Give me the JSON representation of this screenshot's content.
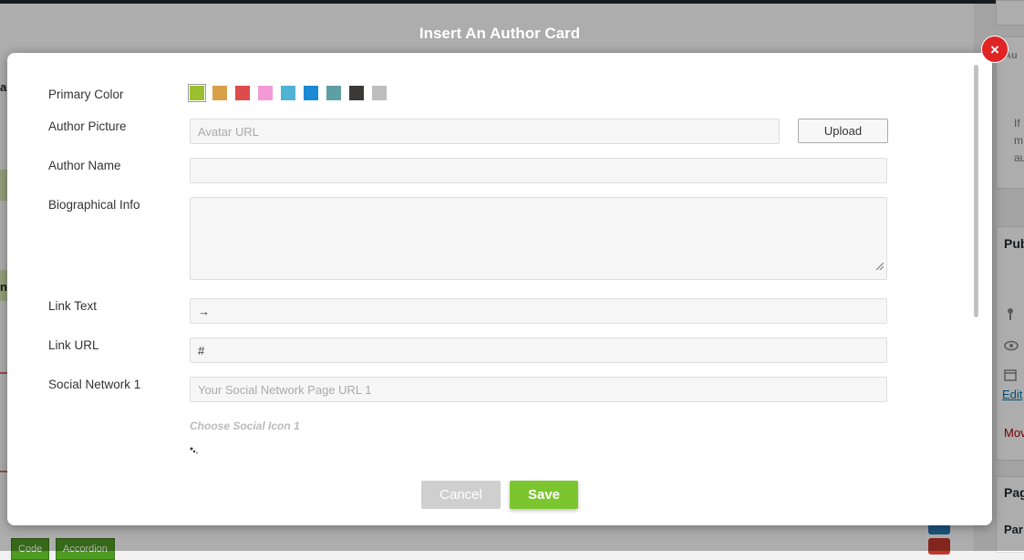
{
  "background": {
    "left_letters": [
      "a",
      "n"
    ],
    "sidebar": {
      "publish_label": "Pub",
      "edit_link": "Edit",
      "move_link": "Mov",
      "page_label": "Pag",
      "parent_label": "Par",
      "top_label": "Au",
      "note_lines": [
        "If",
        "m",
        "au"
      ]
    },
    "bottom_buttons": [
      "Code",
      "Accordion"
    ]
  },
  "modal": {
    "title": "Insert An Author Card",
    "close_glyph": "×",
    "fields": {
      "primary_color_label": "Primary Color",
      "author_picture_label": "Author Picture",
      "author_picture_placeholder": "Avatar URL",
      "upload_label": "Upload",
      "author_name_label": "Author Name",
      "author_name_value": "",
      "bio_label": "Biographical Info",
      "bio_value": "",
      "link_text_label": "Link Text",
      "link_text_value": "→",
      "link_url_label": "Link URL",
      "link_url_value": "#",
      "social_1_label": "Social Network 1",
      "social_1_placeholder": "Your Social Network Page URL 1",
      "choose_icon_label": "Choose Social Icon 1"
    },
    "swatches": [
      {
        "color": "#9bbf2e",
        "selected": true
      },
      {
        "color": "#d9a04a",
        "selected": false
      },
      {
        "color": "#dc4c4c",
        "selected": false
      },
      {
        "color": "#f29ad8",
        "selected": false
      },
      {
        "color": "#4fb3d3",
        "selected": false
      },
      {
        "color": "#1a8ad4",
        "selected": false
      },
      {
        "color": "#5e9fa3",
        "selected": false
      },
      {
        "color": "#3b3838",
        "selected": false
      },
      {
        "color": "#bdbdbd",
        "selected": false
      }
    ],
    "footer": {
      "cancel_label": "Cancel",
      "save_label": "Save"
    }
  }
}
